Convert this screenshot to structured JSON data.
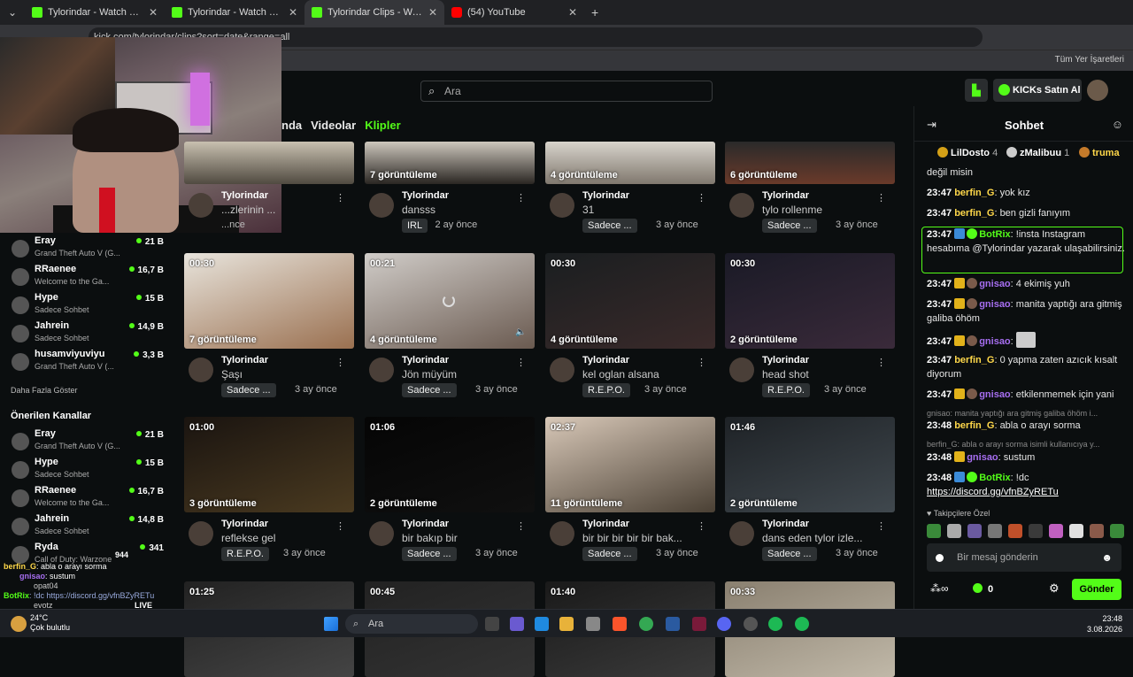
{
  "browser": {
    "tabs": [
      {
        "title": "Tylorindar - Watch clips on Kick",
        "icon": "kick-icon"
      },
      {
        "title": "Tylorindar - Watch clips on Kick",
        "icon": "kick-icon"
      },
      {
        "title": "Tylorindar Clips - Watch Live on",
        "icon": "kick-icon"
      },
      {
        "title": "(54) YouTube",
        "icon": "youtube-icon"
      }
    ],
    "url": "kick.com/tylorindar/clips?sort=date&range=all",
    "bookmarks_label": "Tüm Yer İşaretleri"
  },
  "header": {
    "search_placeholder": "Ara",
    "buy_kicks_label": "KICKs Satın Al"
  },
  "nav_tabs": {
    "partial": "nda",
    "videos": "Videolar",
    "clips": "Klipler"
  },
  "sidebar": {
    "followed": [
      {
        "name": "Eray",
        "category": "Grand Theft Auto V (G...",
        "viewers": "21 B"
      },
      {
        "name": "RRaenee",
        "category": "Welcome to the Ga...",
        "viewers": "16,7 B"
      },
      {
        "name": "Hype",
        "category": "Sadece Sohbet",
        "viewers": "15 B"
      },
      {
        "name": "Jahrein",
        "category": "Sadece Sohbet",
        "viewers": "14,9 B"
      },
      {
        "name": "husamviyuviyu",
        "category": "Grand Theft Auto V (...",
        "viewers": "3,3 B"
      }
    ],
    "show_more": "Daha Fazla Göster",
    "recommended_title": "Önerilen Kanallar",
    "recommended": [
      {
        "name": "Eray",
        "category": "Grand Theft Auto V (G...",
        "viewers": "21 B"
      },
      {
        "name": "Hype",
        "category": "Sadece Sohbet",
        "viewers": "15 B"
      },
      {
        "name": "RRaenee",
        "category": "Welcome to the Ga...",
        "viewers": "16,7 B"
      },
      {
        "name": "Jahrein",
        "category": "Sadece Sohbet",
        "viewers": "14,8 B"
      },
      {
        "name": "Ryda",
        "category": "Call of Duty: Warzone",
        "viewers": "341"
      }
    ]
  },
  "clips": [
    {
      "duration": "",
      "views": "",
      "channel": "Tylorindar",
      "title": "...zlerinin ...",
      "tag": "",
      "ago": "...nce"
    },
    {
      "duration": "",
      "views": "7 görüntüleme",
      "channel": "Tylorindar",
      "title": "dansss",
      "tag": "IRL",
      "ago": "2 ay önce"
    },
    {
      "duration": "",
      "views": "4 görüntüleme",
      "channel": "Tylorindar",
      "title": "31",
      "tag": "Sadece ...",
      "ago": "3 ay önce"
    },
    {
      "duration": "",
      "views": "6 görüntüleme",
      "channel": "Tylorindar",
      "title": "tylo rollenme",
      "tag": "Sadece ...",
      "ago": "3 ay önce"
    },
    {
      "duration": "00:30",
      "views": "7 görüntüleme",
      "channel": "Tylorindar",
      "title": "Şaşı",
      "tag": "Sadece ...",
      "ago": "3 ay önce"
    },
    {
      "duration": "00:21",
      "views": "4 görüntüleme",
      "channel": "Tylorindar",
      "title": "Jön müyüm",
      "tag": "Sadece ...",
      "ago": "3 ay önce"
    },
    {
      "duration": "00:30",
      "views": "4 görüntüleme",
      "channel": "Tylorindar",
      "title": "kel oglan alsana",
      "tag": "R.E.P.O.",
      "ago": "3 ay önce"
    },
    {
      "duration": "00:30",
      "views": "2 görüntüleme",
      "channel": "Tylorindar",
      "title": "head shot",
      "tag": "R.E.P.O.",
      "ago": "3 ay önce"
    },
    {
      "duration": "01:00",
      "views": "3 görüntüleme",
      "channel": "Tylorindar",
      "title": "reflekse gel",
      "tag": "R.E.P.O.",
      "ago": "3 ay önce"
    },
    {
      "duration": "01:06",
      "views": "2 görüntüleme",
      "channel": "Tylorindar",
      "title": "bir bakıp bir",
      "tag": "Sadece ...",
      "ago": "3 ay önce"
    },
    {
      "duration": "02:37",
      "views": "11 görüntüleme",
      "channel": "Tylorindar",
      "title": "bir bir bir bir bir bak...",
      "tag": "Sadece ...",
      "ago": "3 ay önce"
    },
    {
      "duration": "01:46",
      "views": "2 görüntüleme",
      "channel": "Tylorindar",
      "title": "dans eden tylor izle...",
      "tag": "Sadece ...",
      "ago": "3 ay önce"
    },
    {
      "duration": "01:25",
      "views": "",
      "channel": "",
      "title": "",
      "tag": "",
      "ago": ""
    },
    {
      "duration": "00:45",
      "views": "",
      "channel": "",
      "title": "",
      "tag": "",
      "ago": ""
    },
    {
      "duration": "01:40",
      "views": "",
      "channel": "",
      "title": "",
      "tag": "",
      "ago": ""
    },
    {
      "duration": "00:33",
      "views": "",
      "channel": "",
      "title": "",
      "tag": "",
      "ago": ""
    }
  ],
  "chat": {
    "title": "Sohbet",
    "pinned": [
      {
        "name": "LilDosto",
        "count": "4"
      },
      {
        "name": "zMalibuu",
        "count": "1"
      },
      {
        "name": "truma",
        "count": ""
      }
    ],
    "messages": [
      {
        "time": "",
        "user": "",
        "text": "değil misin"
      },
      {
        "time": "23:47",
        "user": "berfin_G",
        "text": "yok kız"
      },
      {
        "time": "23:47",
        "user": "berfin_G",
        "text": "ben gizli fanıyım"
      },
      {
        "time": "23:47",
        "user": "BotRix",
        "text": "!insta Instagram hesabıma @Tylorindar yazarak ulaşabilirsiniz."
      },
      {
        "time": "23:47",
        "user": "gnisao",
        "text": "4 ekimiş yuh"
      },
      {
        "time": "23:47",
        "user": "gnisao",
        "text": "manita yaptığı ara gitmiş galiba öhöm"
      },
      {
        "time": "23:47",
        "user": "gnisao",
        "text": ""
      },
      {
        "time": "23:47",
        "user": "berfin_G",
        "text": "0 yapma zaten azıcık kısalt diyorum"
      },
      {
        "time": "23:47",
        "user": "gnisao",
        "text": "etkilenmemek için yani"
      },
      {
        "time": "23:48",
        "user": "berfin_G",
        "text": "abla o arayı sorma"
      },
      {
        "time": "23:48",
        "user": "gnisao",
        "text": "sustum"
      },
      {
        "time": "23:48",
        "user": "BotRix",
        "text": "!dc"
      }
    ],
    "reply1": "gnisao: manita yaptığı ara gitmiş galiba öhöm i...",
    "reply2": "berfin_G: abla o arayı sorma isimli kullanıcıya y...",
    "discord_link": "https://discord.gg/vfnBZyRETu",
    "emote_label": "Takipçilere Özel",
    "input_placeholder": "Bir mesaj gönderin",
    "kicks_count": "0",
    "send_label": "Gönder"
  },
  "overlay_chat": [
    {
      "user": "berfin_G",
      "text": ": abla o arayı sorma"
    },
    {
      "user": "gnisao",
      "text": ": sustum"
    },
    {
      "user": "BotRix",
      "text": ": !dc https://discord.gg/vfnBZyRETu"
    }
  ],
  "overlay_partial": [
    "opat04",
    "evotz",
    "LIVE",
    "944"
  ],
  "taskbar": {
    "temp": "24°C",
    "weather": "Çok bulutlu",
    "search": "Ara",
    "time": "23:48",
    "date": "3.08.2026"
  },
  "colors": {
    "accent": "#53fc18",
    "background": "#0b0e0f"
  }
}
